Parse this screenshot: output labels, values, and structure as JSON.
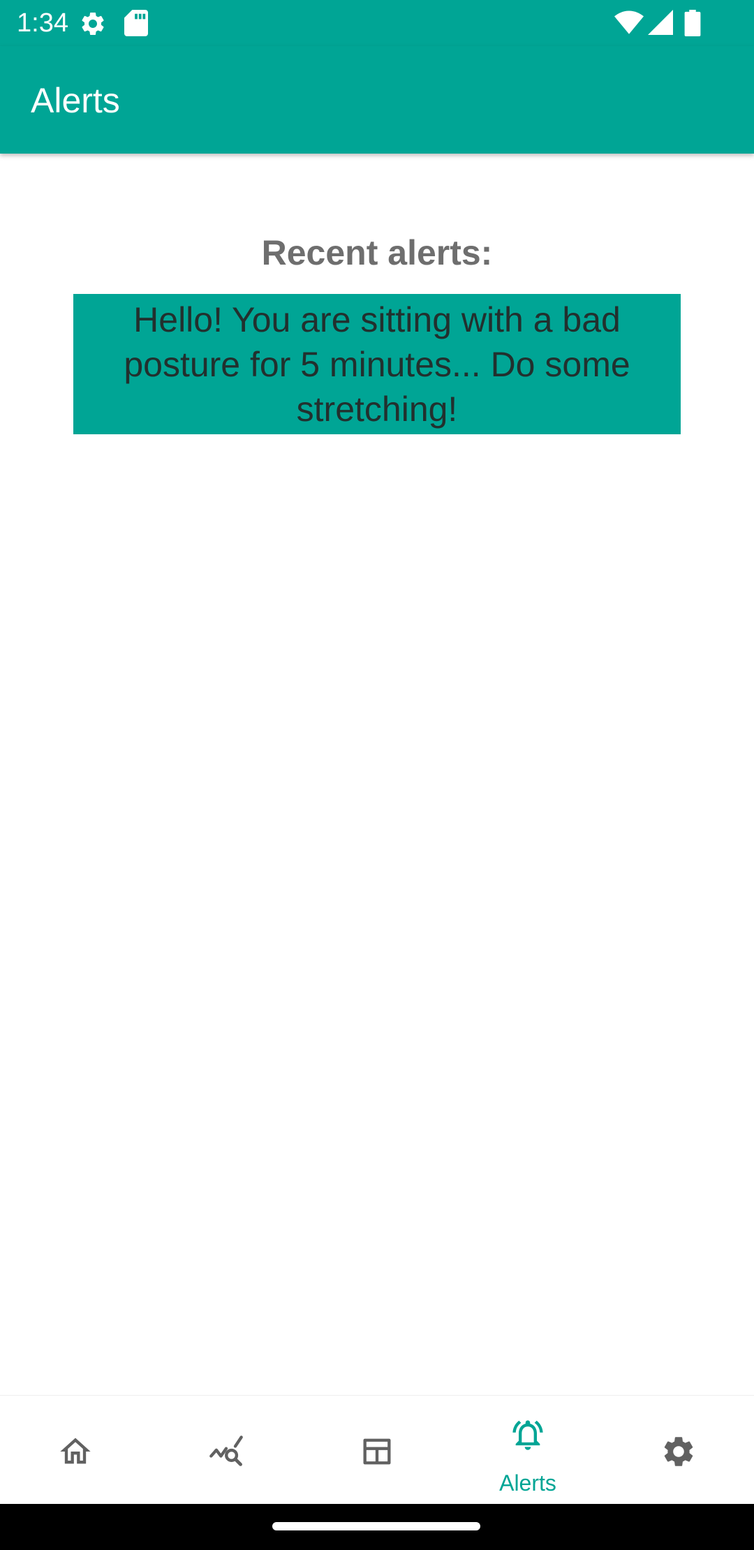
{
  "status_bar": {
    "time": "1:34",
    "icons": [
      "gear-icon",
      "sd-card-icon",
      "wifi-icon",
      "cell-signal-icon",
      "battery-icon"
    ]
  },
  "app_bar": {
    "title": "Alerts"
  },
  "main": {
    "heading": "Recent alerts:",
    "alerts": [
      {
        "message": "Hello! You are sitting with a bad posture for 5 minutes... Do some stretching!"
      }
    ]
  },
  "bottom_nav": {
    "items": [
      {
        "icon": "home-icon",
        "label": ""
      },
      {
        "icon": "chart-search-icon",
        "label": ""
      },
      {
        "icon": "table-icon",
        "label": ""
      },
      {
        "icon": "bell-ring-icon",
        "label": "Alerts",
        "active": true
      },
      {
        "icon": "gear-icon",
        "label": ""
      }
    ]
  },
  "colors": {
    "primary": "#00A595",
    "icon_inactive": "#616161",
    "heading_text": "#6E6E6E"
  }
}
